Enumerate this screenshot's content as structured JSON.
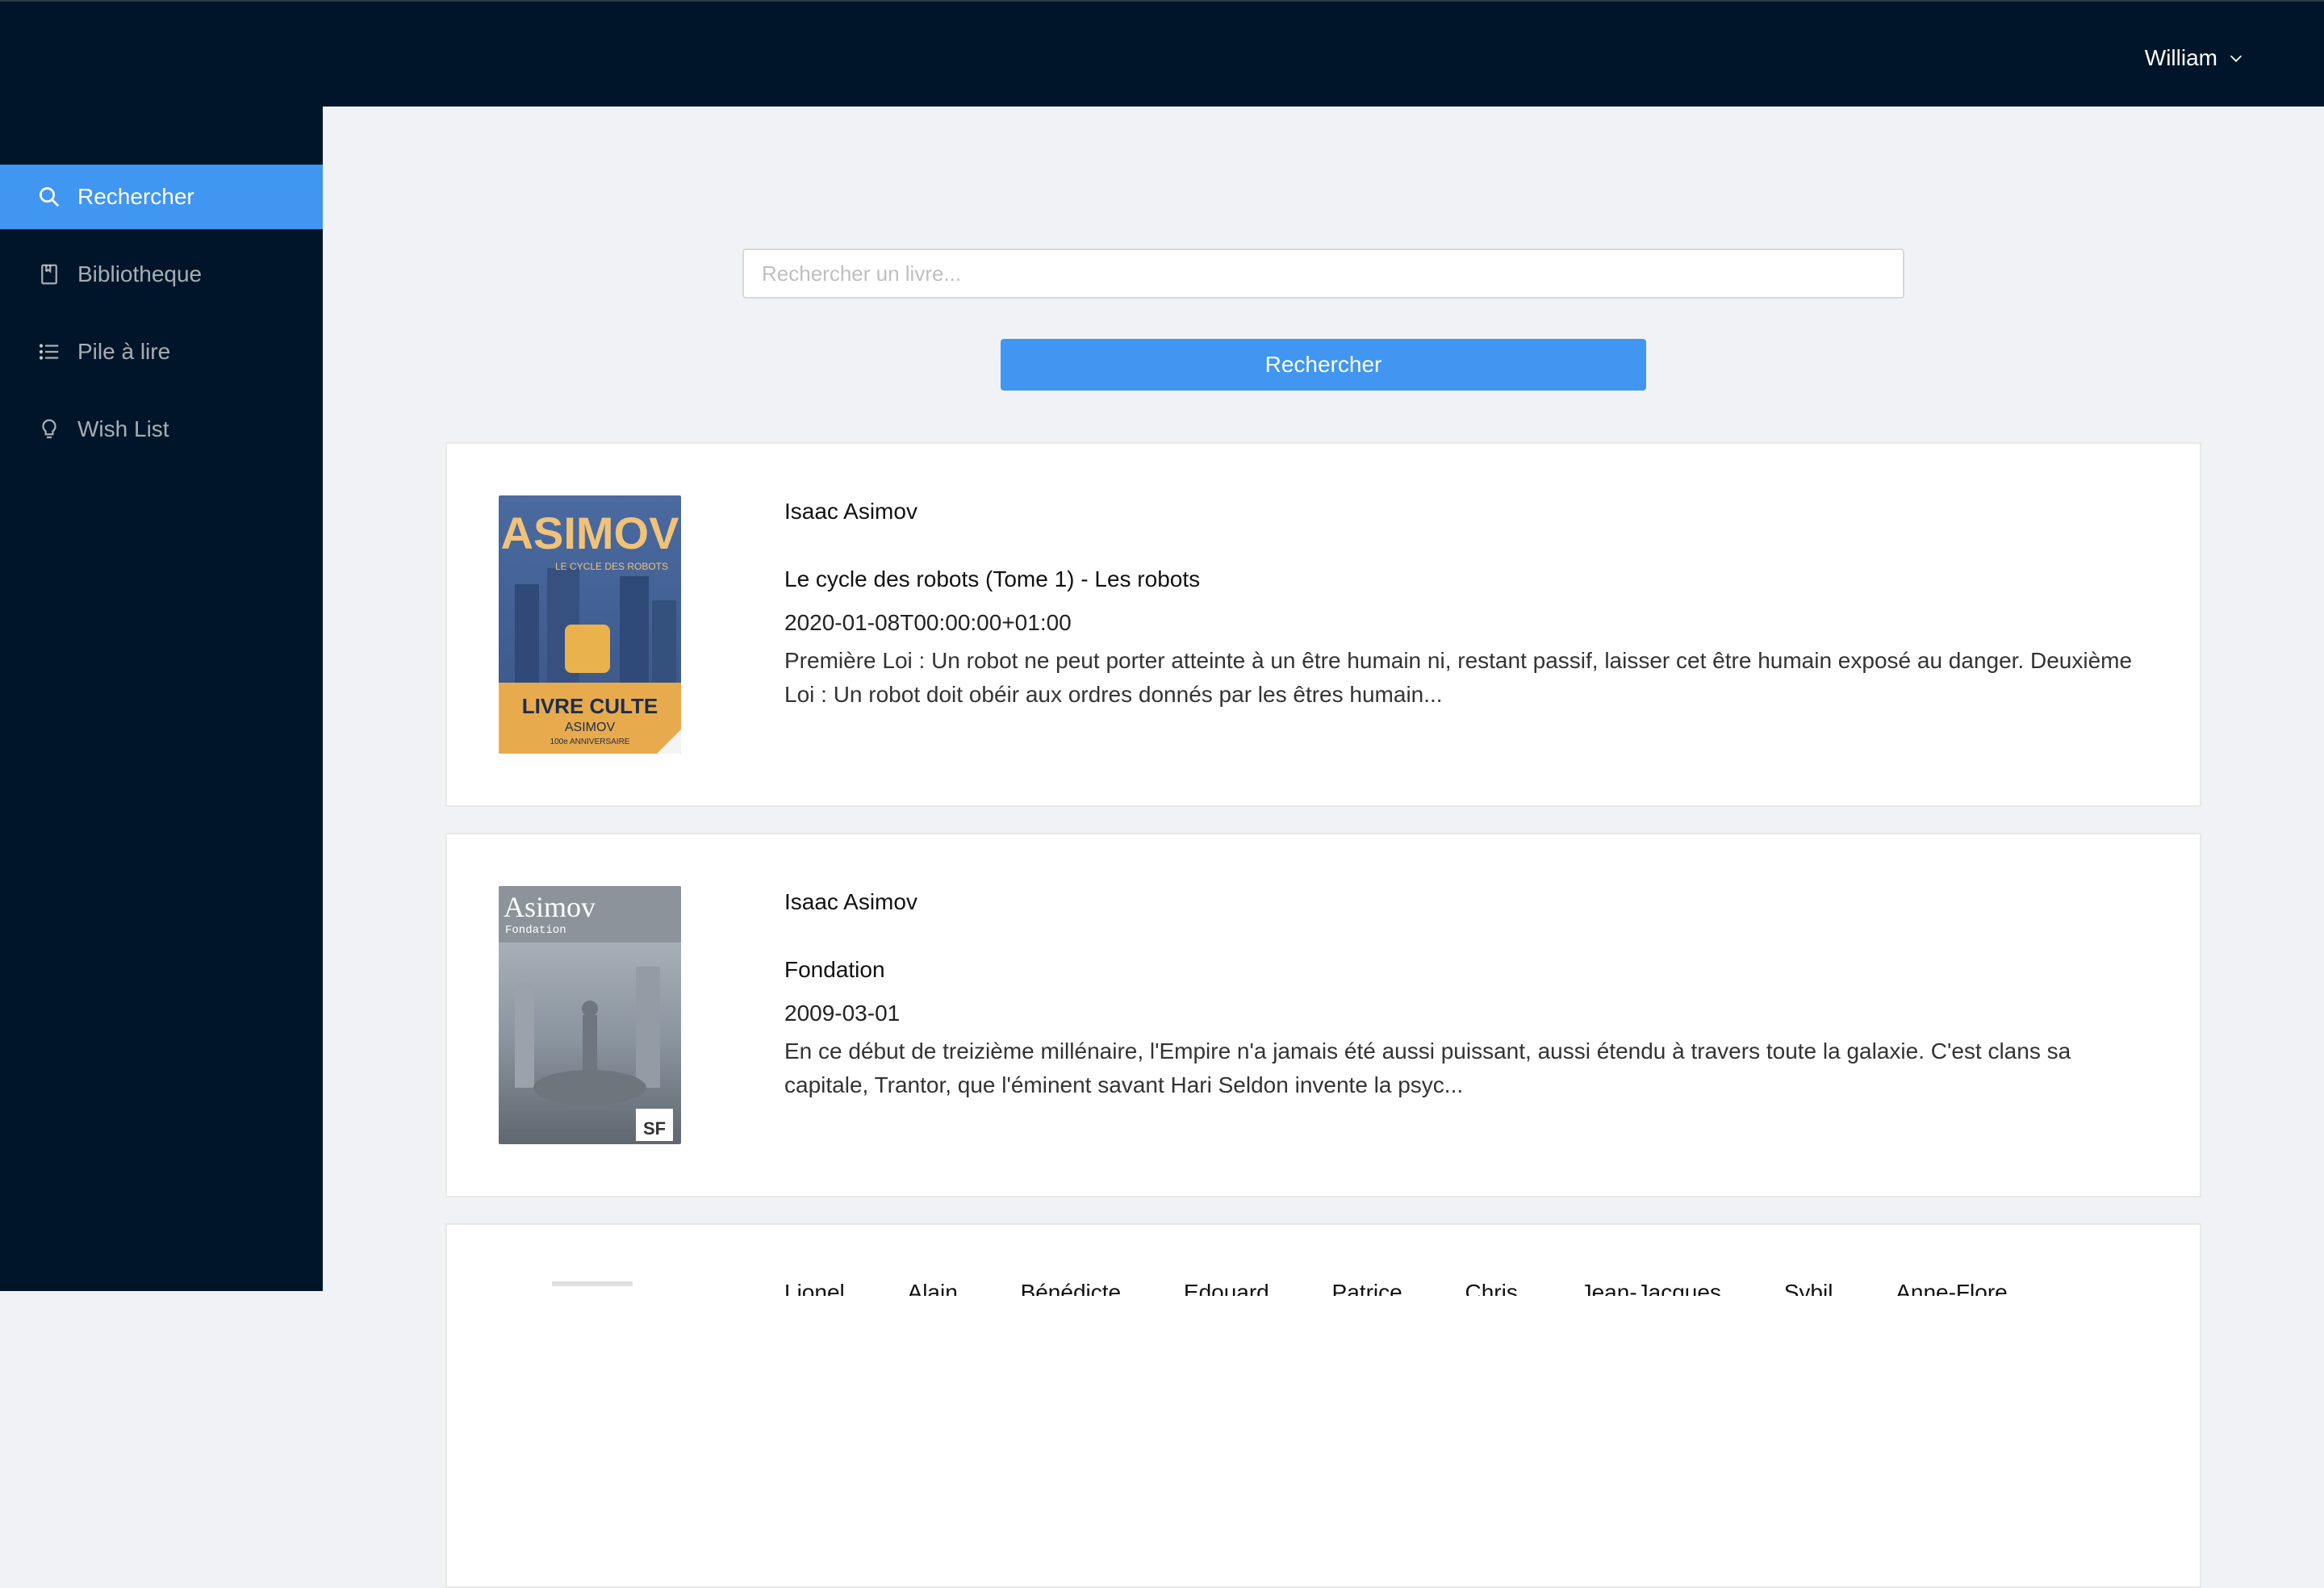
{
  "header": {
    "user_name": "William",
    "user_menu_icon": "chevron-down-icon",
    "background": "#001529"
  },
  "sidebar": {
    "background": "#001529",
    "active_color": "#4096f0",
    "items": [
      {
        "label": "Rechercher",
        "icon": "search-icon",
        "active": true
      },
      {
        "label": "Bibliotheque",
        "icon": "book-icon",
        "active": false
      },
      {
        "label": "Pile à lire",
        "icon": "list-icon",
        "active": false
      },
      {
        "label": "Wish List",
        "icon": "bulb-icon",
        "active": false
      }
    ]
  },
  "search": {
    "placeholder": "Rechercher un livre...",
    "value": "",
    "button_label": "Rechercher"
  },
  "results": [
    {
      "author": "Isaac Asimov",
      "title": "Le cycle des robots (Tome 1) - Les robots",
      "date": "2020-01-08T00:00:00+01:00",
      "description": "Première Loi : Un robot ne peut porter atteinte à un être humain ni, restant passif, laisser cet être humain exposé au danger. Deuxième Loi : Un robot doit obéir aux ordres donnés par les êtres humain...",
      "cover": {
        "name": "ASIMOV",
        "subtitle": "LE CYCLE DES ROBOTS",
        "band": "LIVRE CULTE",
        "band_sub": "ASIMOV",
        "band_sub2": "100e ANNIVERSAIRE"
      }
    },
    {
      "author": "Isaac Asimov",
      "title": "Fondation",
      "date": "2009-03-01",
      "description": "En ce début de treizième millénaire, l'Empire n'a jamais été aussi puissant, aussi étendu à travers toute la galaxie. C'est clans sa capitale, Trantor, que l'éminent savant Hari Seldon invente la psyc...",
      "cover": {
        "name": "Asimov",
        "subtitle": "Fondation",
        "badge": "SF"
      }
    },
    {
      "authors": [
        "Lionel",
        "Alain",
        "Bénédicte",
        "Edouard",
        "Patrice",
        "Chris",
        "Jean-Jacques",
        "Sybil",
        "Anne-Flore"
      ]
    }
  ]
}
